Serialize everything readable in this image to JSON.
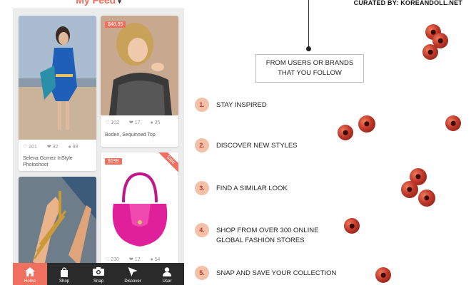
{
  "app": {
    "title": "My Feed",
    "accent_color": "#f07060",
    "cards": [
      {
        "id": "card-1",
        "price": "",
        "likes": "201",
        "hearts": "32",
        "comments": "98",
        "caption": "Selena Gomez InStyle Photoshoot"
      },
      {
        "id": "card-2",
        "price": "$48.95",
        "likes": "102",
        "hearts": "17",
        "comments": "35",
        "caption": "Boden, Sequinned Top"
      },
      {
        "id": "card-3",
        "price": "",
        "likes": "",
        "hearts": "",
        "comments": "",
        "caption": ""
      },
      {
        "id": "card-4",
        "price": "$199",
        "sale": "Sale",
        "likes": "230",
        "hearts": "12",
        "comments": "54",
        "caption": ""
      }
    ],
    "tabs": [
      {
        "label": "Home",
        "icon": "home-icon",
        "active": true
      },
      {
        "label": "Shop",
        "icon": "shopping-bag-icon",
        "active": false
      },
      {
        "label": "Snap",
        "icon": "camera-icon",
        "active": false
      },
      {
        "label": "Discover",
        "icon": "cursor-arrow-icon",
        "active": false
      },
      {
        "label": "User",
        "icon": "user-icon",
        "active": false
      }
    ]
  },
  "infographic": {
    "curated_by": "CURATED BY: KOREANDOLL.NET",
    "source_line1": "FROM USERS OR BRANDS",
    "source_line2": "THAT YOU FOLLOW",
    "steps": [
      {
        "num": "1.",
        "line1": "STAY INSPIRED",
        "line2": ""
      },
      {
        "num": "2.",
        "line1": "DISCOVER NEW STYLES",
        "line2": ""
      },
      {
        "num": "3.",
        "line1": "FIND A SIMILAR LOOK",
        "line2": ""
      },
      {
        "num": "4.",
        "line1": "SHOP FROM OVER 300 ONLINE",
        "line2": "GLOBAL FASHION STORES"
      },
      {
        "num": "5.",
        "line1": "SNAP AND SAVE YOUR COLLECTION",
        "line2": ""
      }
    ]
  }
}
